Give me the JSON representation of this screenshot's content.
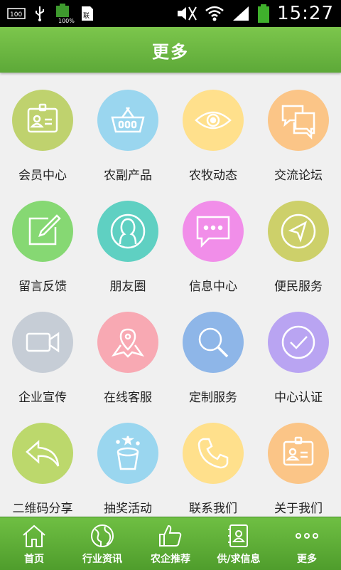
{
  "status_bar": {
    "time": "15:27",
    "battery_text": "100%",
    "signal_icons": [
      "sim-icon",
      "usb-icon",
      "battery-icon",
      "sd-icon",
      "mute-icon",
      "wifi-icon",
      "signal-icon",
      "battery-full-icon"
    ]
  },
  "header": {
    "title": "更多"
  },
  "grid": {
    "items": [
      {
        "label": "会员中心",
        "icon": "member-card-icon",
        "color": "#bfd26e"
      },
      {
        "label": "农副产品",
        "icon": "basket-icon",
        "color": "#9ad6ef"
      },
      {
        "label": "农牧动态",
        "icon": "eye-icon",
        "color": "#ffe08c"
      },
      {
        "label": "交流论坛",
        "icon": "chat-bubbles-icon",
        "color": "#fbc587"
      },
      {
        "label": "留言反馈",
        "icon": "edit-note-icon",
        "color": "#86d873"
      },
      {
        "label": "朋友圈",
        "icon": "friend-profile-icon",
        "color": "#5fd0c2"
      },
      {
        "label": "信息中心",
        "icon": "message-icon",
        "color": "#f18ee9"
      },
      {
        "label": "便民服务",
        "icon": "navigation-icon",
        "color": "#cdd06a"
      },
      {
        "label": "企业宣传",
        "icon": "video-camera-icon",
        "color": "#c6cdd6"
      },
      {
        "label": "在线客服",
        "icon": "map-pin-icon",
        "color": "#f8a9b3"
      },
      {
        "label": "定制服务",
        "icon": "magnifier-icon",
        "color": "#8eb6e8"
      },
      {
        "label": "中心认证",
        "icon": "check-circle-icon",
        "color": "#b9a4f2"
      },
      {
        "label": "二维码分享",
        "icon": "share-arrow-icon",
        "color": "#bcd86c"
      },
      {
        "label": "抽奖活动",
        "icon": "magic-hat-icon",
        "color": "#9ad6ef"
      },
      {
        "label": "联系我们",
        "icon": "phone-icon",
        "color": "#ffe08c"
      },
      {
        "label": "关于我们",
        "icon": "id-badge-icon",
        "color": "#fbc587"
      }
    ]
  },
  "bottom_nav": {
    "items": [
      {
        "label": "首页",
        "icon": "home-icon"
      },
      {
        "label": "行业资讯",
        "icon": "globe-icon"
      },
      {
        "label": "农企推荐",
        "icon": "thumbs-up-icon"
      },
      {
        "label": "供/求信息",
        "icon": "contacts-book-icon"
      },
      {
        "label": "更多",
        "icon": "more-dots-icon"
      }
    ]
  },
  "colors": {
    "header_green": "#68b43f",
    "nav_green": "#5aa834",
    "background": "#f0f0f0"
  }
}
